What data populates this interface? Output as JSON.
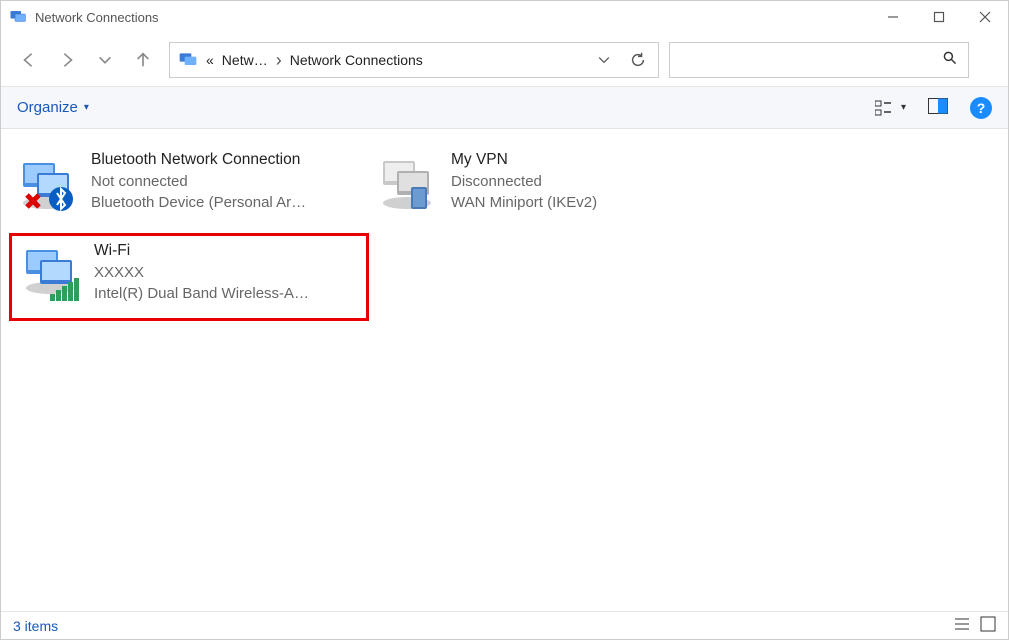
{
  "window": {
    "title": "Network Connections"
  },
  "nav": {
    "breadcrumb": {
      "prefix": "«",
      "part1": "Netw…",
      "part2": "Network Connections"
    }
  },
  "toolbar": {
    "organize": "Organize"
  },
  "connections": [
    {
      "name": "Bluetooth Network Connection",
      "status": "Not connected",
      "device": "Bluetooth Device (Personal Ar…",
      "icon": "bluetooth",
      "highlighted": false
    },
    {
      "name": "My VPN",
      "status": "Disconnected",
      "device": "WAN Miniport (IKEv2)",
      "icon": "vpn",
      "highlighted": false
    },
    {
      "name": "Wi-Fi",
      "status": "XXXXX",
      "device": "Intel(R) Dual Band Wireless-A…",
      "icon": "wifi",
      "highlighted": true
    }
  ],
  "status": {
    "text": "3 items"
  }
}
